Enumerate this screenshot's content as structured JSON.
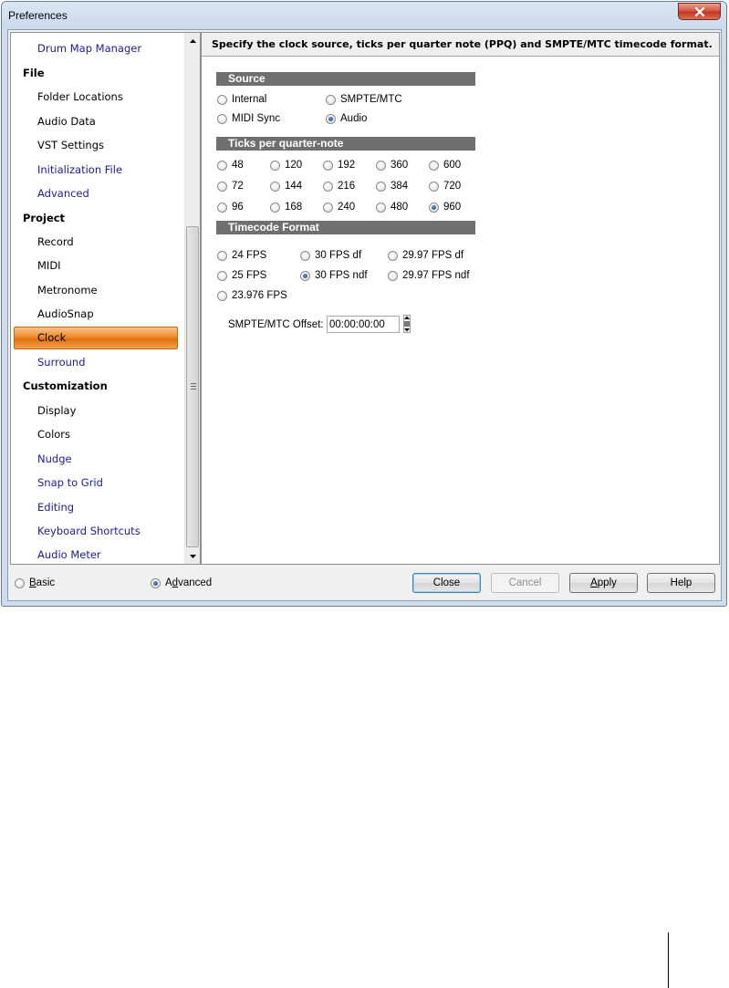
{
  "window": {
    "title": "Preferences"
  },
  "sidebar": {
    "items": [
      {
        "label": "Drum Map Manager",
        "kind": "child",
        "color": "blue"
      },
      {
        "label": "File",
        "kind": "category"
      },
      {
        "label": "Folder Locations",
        "kind": "child"
      },
      {
        "label": "Audio Data",
        "kind": "child"
      },
      {
        "label": "VST Settings",
        "kind": "child"
      },
      {
        "label": "Initialization File",
        "kind": "child",
        "color": "blue"
      },
      {
        "label": "Advanced",
        "kind": "child",
        "color": "blue"
      },
      {
        "label": "Project",
        "kind": "category"
      },
      {
        "label": "Record",
        "kind": "child"
      },
      {
        "label": "MIDI",
        "kind": "child"
      },
      {
        "label": "Metronome",
        "kind": "child"
      },
      {
        "label": "AudioSnap",
        "kind": "child"
      },
      {
        "label": "Clock",
        "kind": "child",
        "selected": true
      },
      {
        "label": "Surround",
        "kind": "child",
        "color": "blue"
      },
      {
        "label": "Customization",
        "kind": "category"
      },
      {
        "label": "Display",
        "kind": "child"
      },
      {
        "label": "Colors",
        "kind": "child"
      },
      {
        "label": "Nudge",
        "kind": "child",
        "color": "blue"
      },
      {
        "label": "Snap to Grid",
        "kind": "child",
        "color": "blue"
      },
      {
        "label": "Editing",
        "kind": "child",
        "color": "blue"
      },
      {
        "label": "Keyboard Shortcuts",
        "kind": "child",
        "color": "blue"
      },
      {
        "label": "Audio Meter",
        "kind": "child",
        "color": "blue"
      }
    ]
  },
  "content": {
    "description": "Specify the clock source, ticks per quarter note (PPQ) and SMPTE/MTC  timecode format.",
    "source": {
      "header": "Source",
      "options": [
        {
          "label": "Internal",
          "checked": false
        },
        {
          "label": "SMPTE/MTC",
          "checked": false
        },
        {
          "label": "MIDI Sync",
          "checked": false
        },
        {
          "label": "Audio",
          "checked": true
        }
      ]
    },
    "ticks": {
      "header": "Ticks per quarter-note",
      "options": [
        {
          "label": "48",
          "checked": false
        },
        {
          "label": "120",
          "checked": false
        },
        {
          "label": "192",
          "checked": false
        },
        {
          "label": "360",
          "checked": false
        },
        {
          "label": "600",
          "checked": false
        },
        {
          "label": "72",
          "checked": false
        },
        {
          "label": "144",
          "checked": false
        },
        {
          "label": "216",
          "checked": false
        },
        {
          "label": "384",
          "checked": false
        },
        {
          "label": "720",
          "checked": false
        },
        {
          "label": "96",
          "checked": false
        },
        {
          "label": "168",
          "checked": false
        },
        {
          "label": "240",
          "checked": false
        },
        {
          "label": "480",
          "checked": false
        },
        {
          "label": "960",
          "checked": true
        }
      ]
    },
    "timecode": {
      "header": "Timecode Format",
      "options": [
        {
          "label": "24 FPS",
          "checked": false
        },
        {
          "label": "30 FPS df",
          "checked": false
        },
        {
          "label": "29.97 FPS df",
          "checked": false
        },
        {
          "label": "25 FPS",
          "checked": false
        },
        {
          "label": "30 FPS ndf",
          "checked": true
        },
        {
          "label": "29.97 FPS ndf",
          "checked": false
        },
        {
          "label": "23.976 FPS",
          "checked": false
        }
      ]
    },
    "offset": {
      "label": "SMPTE/MTC Offset:",
      "value": "00:00:00:00"
    }
  },
  "footer": {
    "mode": {
      "basic_key": "B",
      "basic_rest": "asic",
      "basic_checked": false,
      "advanced_pre": "A",
      "advanced_key": "d",
      "advanced_rest": "vanced",
      "advanced_checked": true
    },
    "buttons": {
      "close": "Close",
      "cancel": "Cancel",
      "apply_key": "A",
      "apply_rest": "pply",
      "help": "Help"
    }
  },
  "colors": {
    "selection_orange": "#f08c2c",
    "section_header_gray": "#6f6f6f",
    "nav_blue": "#1c1c8c",
    "close_red": "#c0321c"
  }
}
